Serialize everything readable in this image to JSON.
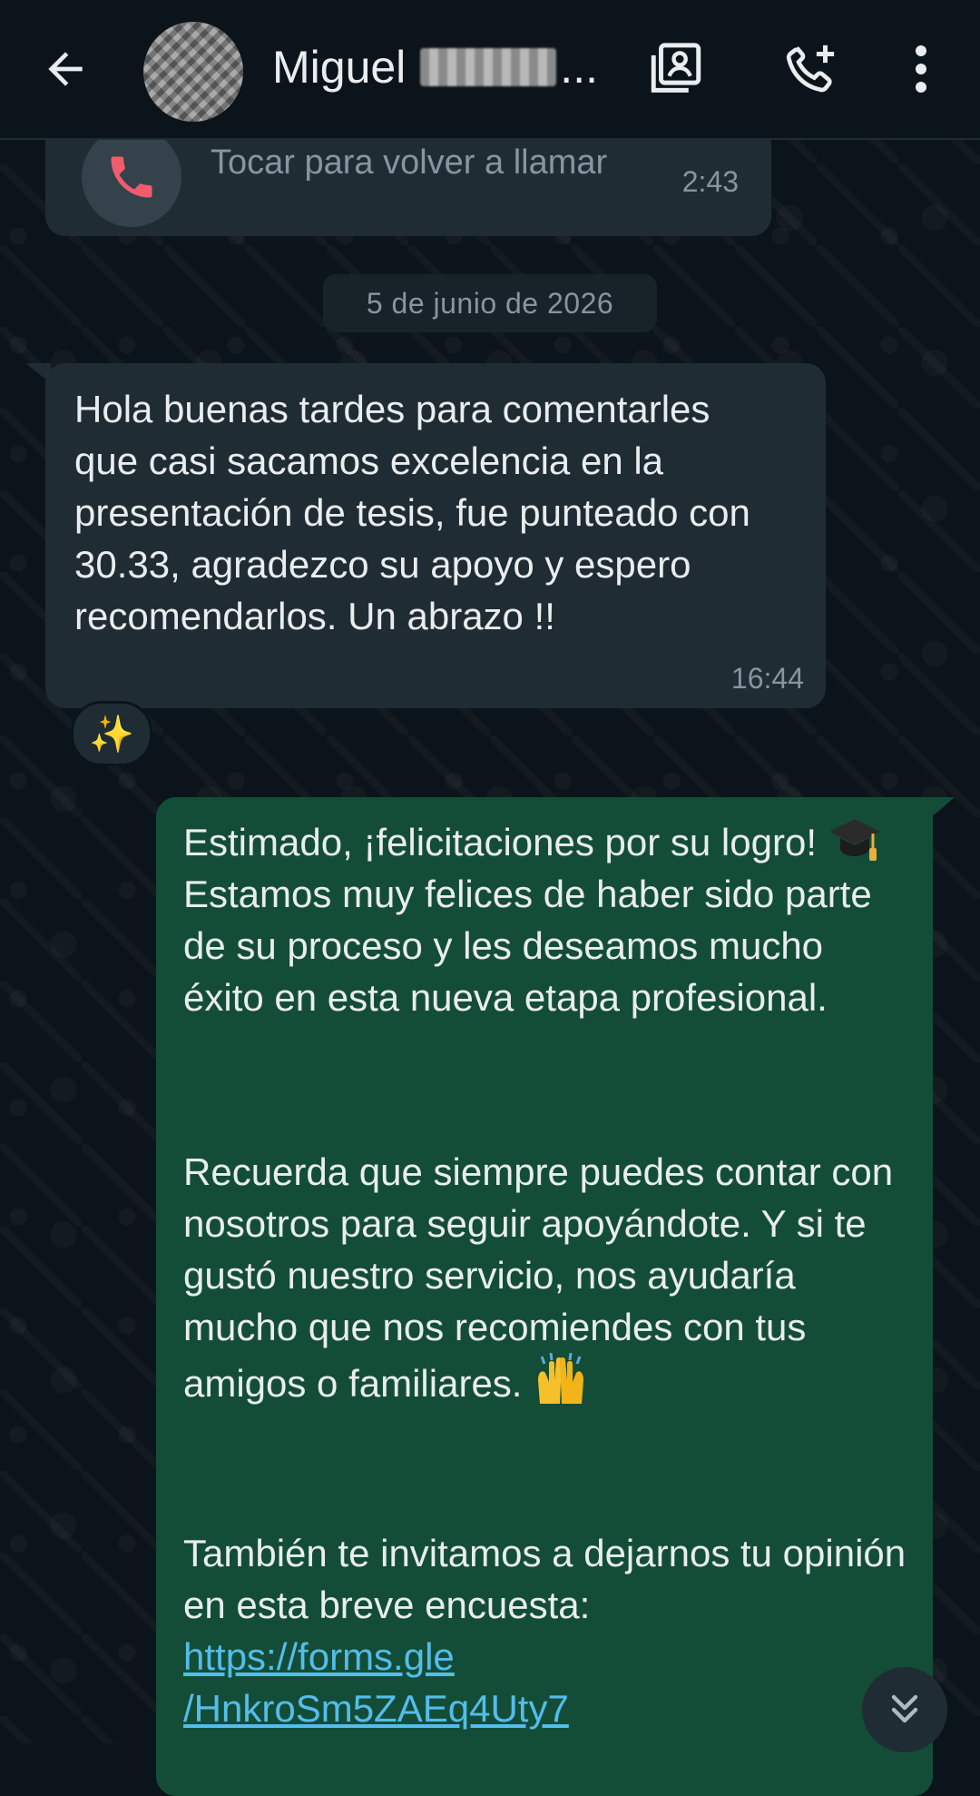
{
  "header": {
    "contact_name": "Miguel",
    "name_truncation": "..."
  },
  "call": {
    "text": "Tocar para volver a llamar",
    "time": "2:43"
  },
  "date_separator": "5 de junio de 2026",
  "incoming_message": {
    "text": "Hola buenas tardes para comentarles que casi sacamos excelencia en la presentación de tesis, fue punteado con 30.33, agradezco su apoyo y espero recomendarlos. Un abrazo !!",
    "time": "16:44",
    "reaction": "✨"
  },
  "outgoing_message": {
    "para1_before_emoji": "Estimado, ¡felicitaciones por su logro! ",
    "para1_after_emoji": " Estamos muy felices de haber sido parte de su proceso y les deseamos mucho éxito en esta nueva etapa profesional.",
    "para2_before_emoji": "Recuerda que siempre puedes contar con nosotros para seguir apoyándote. Y si te gustó nuestro servicio, nos ayudaría mucho que nos recomiendes con tus amigos o familiares. ",
    "para3_text": "También te invitamos a dejarnos tu opinión en esta breve encuesta:",
    "link_line1": "https://forms.gle",
    "link_line2": "/HnkroSm5ZAEq4Uty7"
  },
  "icons": {
    "back": "arrow-left-icon",
    "contact": "contact-card-icon",
    "call": "add-call-icon",
    "menu": "more-vertical-icon",
    "missed_call": "missed-call-icon",
    "reaction": "sparkles-icon",
    "graduation": "graduation-cap-emoji",
    "hands": "raising-hands-emoji",
    "scroll": "double-chevron-down-icon"
  },
  "colors": {
    "background": "#0b141a",
    "incoming_bubble": "#202c33",
    "outgoing_bubble": "#144d37",
    "secondary_text": "#8696a0",
    "link": "#53bdeb",
    "missed_call_red": "#f15c6d"
  }
}
